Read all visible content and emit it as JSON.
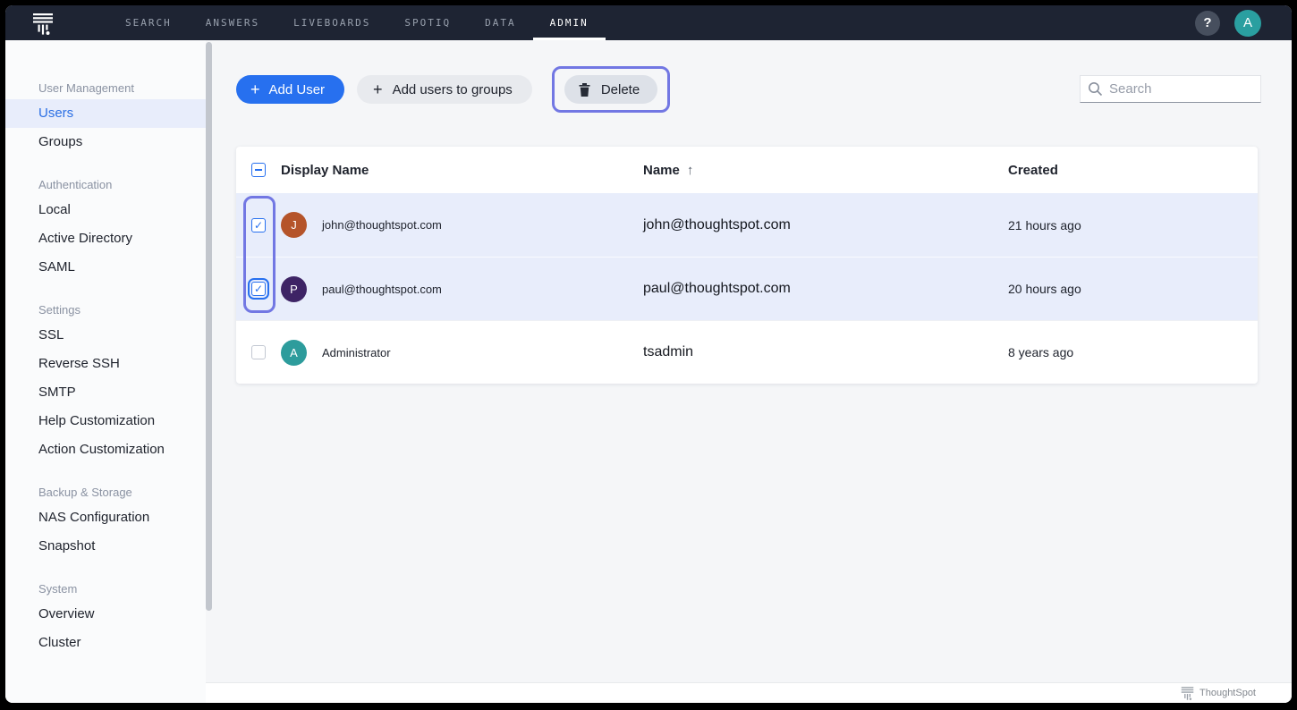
{
  "nav": {
    "brand": "ThoughtSpot",
    "items": [
      {
        "label": "SEARCH",
        "active": false
      },
      {
        "label": "ANSWERS",
        "active": false
      },
      {
        "label": "LIVEBOARDS",
        "active": false
      },
      {
        "label": "SPOTIQ",
        "active": false
      },
      {
        "label": "DATA",
        "active": false
      },
      {
        "label": "ADMIN",
        "active": true
      }
    ],
    "help_label": "?",
    "avatar_initial": "A"
  },
  "sidebar": {
    "active_item": "Users",
    "sections": [
      {
        "heading": "User Management",
        "items": [
          "Users",
          "Groups"
        ]
      },
      {
        "heading": "Authentication",
        "items": [
          "Local",
          "Active Directory",
          "SAML"
        ]
      },
      {
        "heading": "Settings",
        "items": [
          "SSL",
          "Reverse SSH",
          "SMTP",
          "Help Customization",
          "Action Customization"
        ]
      },
      {
        "heading": "Backup & Storage",
        "items": [
          "NAS Configuration",
          "Snapshot"
        ]
      },
      {
        "heading": "System",
        "items": [
          "Overview",
          "Cluster"
        ]
      }
    ]
  },
  "toolbar": {
    "add_user_label": "Add User",
    "add_users_to_groups_label": "Add users to groups",
    "delete_label": "Delete",
    "plus_glyph": "+",
    "search_placeholder": "Search"
  },
  "table": {
    "headers": {
      "display_name": "Display Name",
      "name": "Name",
      "sort_arrow": "↑",
      "created": "Created"
    },
    "rows": [
      {
        "initial": "J",
        "avatar_color": "#b5542a",
        "display_name": "john@thoughtspot.com",
        "name": "john@thoughtspot.com",
        "created": "21 hours ago",
        "selected": true,
        "checked": true
      },
      {
        "initial": "P",
        "avatar_color": "#3e2465",
        "display_name": "paul@thoughtspot.com",
        "name": "paul@thoughtspot.com",
        "created": "20 hours ago",
        "selected": true,
        "checked": true,
        "focused": true
      },
      {
        "initial": "A",
        "avatar_color": "#2d9c9c",
        "display_name": "Administrator",
        "name": "tsadmin",
        "created": "8 years ago",
        "selected": false,
        "checked": false
      }
    ],
    "check_glyph": "✓"
  },
  "footer": {
    "brand": "ThoughtSpot"
  },
  "colors": {
    "accent_blue": "#2770ef",
    "selected_row_bg": "#e8edfb",
    "annotation_purple": "#7277e3",
    "nav_bg": "#1e2433",
    "avatar_teal": "#2a9fa0"
  }
}
